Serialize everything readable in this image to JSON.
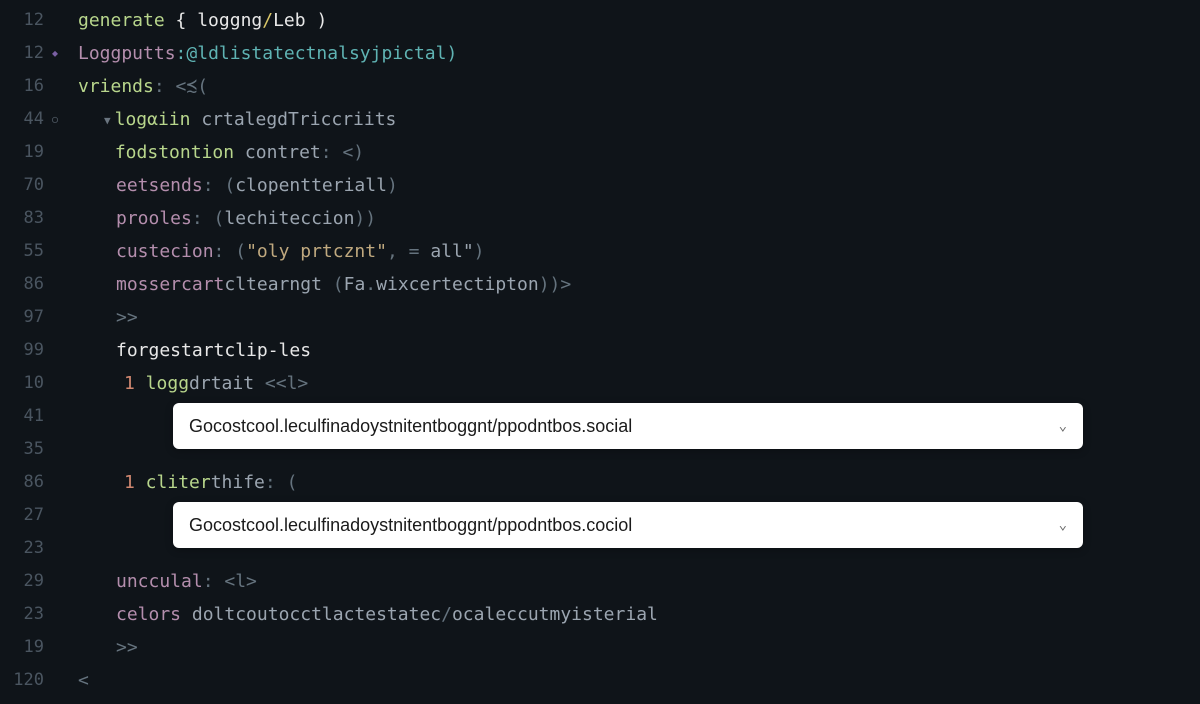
{
  "gutter": {
    "lines": [
      "12",
      "12",
      "16",
      "44",
      "19",
      "70",
      "83",
      "55",
      "86",
      "97",
      "99",
      "10",
      "41",
      "35",
      "86",
      "27",
      "23",
      "29",
      "23",
      "19",
      "120"
    ],
    "markers": {
      "1": "diamond",
      "3": "circle-triangle"
    }
  },
  "code": {
    "line1": {
      "kw1": "generate",
      "sym1": " { ",
      "kw2": "loggng",
      "sym2": "/",
      "kw3": "Leb",
      "sym3": " )"
    },
    "line2": {
      "kw1": "Loggputts",
      "sym1": ":",
      "kw2": "@ldlistatectnalsyjpictal",
      "sym2": ")"
    },
    "line3": {
      "kw1": "vriends",
      "sym1": ": <≾("
    },
    "line4": {
      "kw1": "logαiin",
      "kw2": " crtalegdTriccriits"
    },
    "line5": {
      "kw1": "fodstontion",
      "kw2": " contret",
      "sym1": ": <)"
    },
    "line6": {
      "kw1": "eetsends",
      "sym1": ": (",
      "kw2": "clopentteriall",
      "sym2": ")"
    },
    "line7": {
      "kw1": "prooles",
      "sym1": ": (",
      "kw2": "lechiteccion",
      "sym2": "))"
    },
    "line8": {
      "kw1": "custecion",
      "sym1": ": (",
      "str1": "\"oly prtcznt\"",
      "sym2": ", = ",
      "str2": "all\"",
      "sym3": ")"
    },
    "line9": {
      "kw1": "mossercart",
      "kw2": "cltearngt",
      "sym1": " (",
      "kw3": "Fa",
      "sym2": ".",
      "kw4": "wixcertectipton",
      "sym3": "))>"
    },
    "line10": {
      "sym1": ">>"
    },
    "line11": {
      "kw1": "forgestartclip-les"
    },
    "line12": {
      "num1": "1",
      "kw1": " logg",
      "kw2": "drtait",
      "sym1": " <<l>"
    },
    "line15": {
      "num1": "1",
      "kw1": " cliter",
      "kw2": "thife",
      "sym1": ": ("
    },
    "line18": {
      "kw1": "uncculal",
      "sym1": ": <l>"
    },
    "line19": {
      "kw1": "celors",
      "kw2": " doltcoutocctlactestatec",
      "sym1": "/",
      "kw3": "ocaleccutmyisterial"
    },
    "line20": {
      "sym1": ">>"
    },
    "line21": {
      "sym1": "<"
    }
  },
  "dropdowns": {
    "option1": "Gocostcool.leculfinadoystnitentboggnt/ppodntbos.social",
    "option2": "Gocostcool.leculfinadoystnitentboggnt/ppodntbos.cociol"
  }
}
